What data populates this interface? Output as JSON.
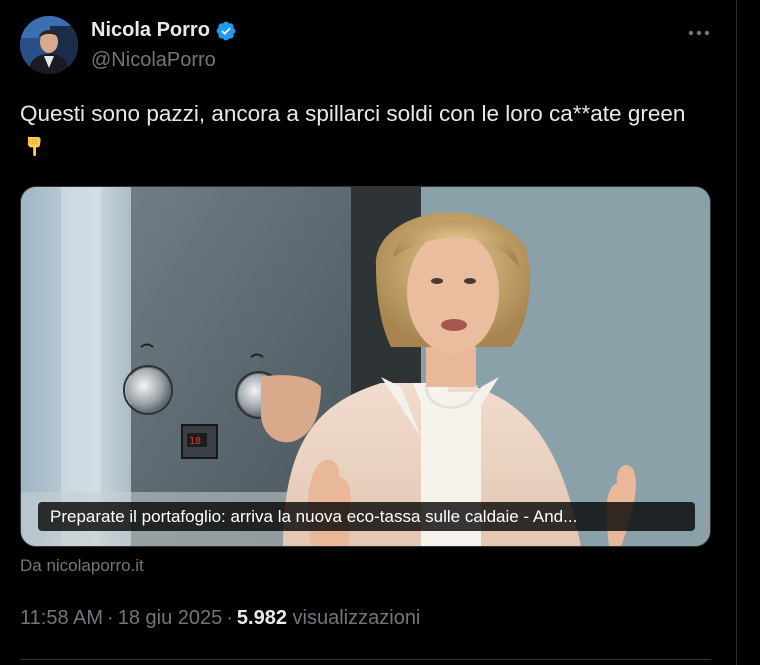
{
  "author": {
    "display_name": "Nicola Porro",
    "handle": "@NicolaPorro",
    "verified": true,
    "avatar_icon": "avatar-photo"
  },
  "more_icon": "more-horizontal-icon",
  "tweet": {
    "text": "Questi sono pazzi, ancora a spillarci soldi con le loro ca**ate green",
    "emoji": "backhand-index-pointing-down"
  },
  "card": {
    "title": "Preparate il portafoglio: arriva la nuova eco-tassa sulle caldaie - And...",
    "source": "Da nicolaporro.it",
    "thermostat_display": "18"
  },
  "meta": {
    "time": "11:58 AM",
    "date": "18 giu 2025",
    "separator": "·",
    "views_count": "5.982",
    "views_label": "visualizzazioni"
  },
  "colors": {
    "background": "#000000",
    "text_primary": "#e7e9ea",
    "text_secondary": "#71767b",
    "verified_blue": "#1d9bf0",
    "border": "#2f3336"
  }
}
